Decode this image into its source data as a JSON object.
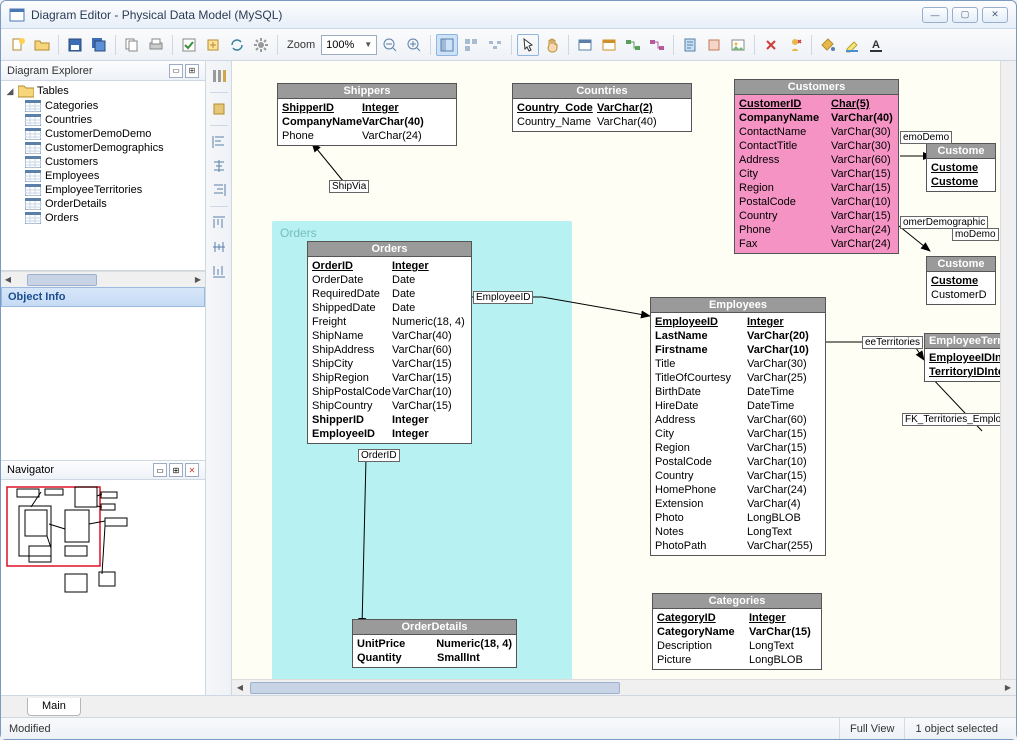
{
  "window": {
    "title": "Diagram Editor - Physical Data Model (MySQL)"
  },
  "toolbar": {
    "zoom_label": "Zoom",
    "zoom_value": "100%"
  },
  "explorer": {
    "title": "Diagram Explorer",
    "root": "Tables",
    "items": [
      "Categories",
      "Countries",
      "CustomerDemoDemo",
      "CustomerDemographics",
      "Customers",
      "Employees",
      "EmployeeTerritories",
      "OrderDetails",
      "Orders"
    ]
  },
  "objectinfo_title": "Object Info",
  "navigator_title": "Navigator",
  "tab_main": "Main",
  "status": {
    "left": "Modified",
    "mode": "Full View",
    "sel": "1 object selected"
  },
  "entities": {
    "shippers": {
      "title": "Shippers",
      "rows": [
        {
          "n": "ShipperID",
          "t": "Integer",
          "pk": true
        },
        {
          "n": "CompanyName",
          "t": "VarChar(40)",
          "fk": true
        },
        {
          "n": "Phone",
          "t": "VarChar(24)"
        }
      ]
    },
    "countries": {
      "title": "Countries",
      "rows": [
        {
          "n": "Country_Code",
          "t": "VarChar(2)",
          "pk": true
        },
        {
          "n": "Country_Name",
          "t": "VarChar(40)"
        }
      ]
    },
    "customers": {
      "title": "Customers",
      "rows": [
        {
          "n": "CustomerID",
          "t": "Char(5)",
          "pk": true
        },
        {
          "n": "CompanyName",
          "t": "VarChar(40)",
          "fk": true
        },
        {
          "n": "ContactName",
          "t": "VarChar(30)"
        },
        {
          "n": "ContactTitle",
          "t": "VarChar(30)"
        },
        {
          "n": "Address",
          "t": "VarChar(60)"
        },
        {
          "n": "City",
          "t": "VarChar(15)"
        },
        {
          "n": "Region",
          "t": "VarChar(15)"
        },
        {
          "n": "PostalCode",
          "t": "VarChar(10)"
        },
        {
          "n": "Country",
          "t": "VarChar(15)"
        },
        {
          "n": "Phone",
          "t": "VarChar(24)"
        },
        {
          "n": "Fax",
          "t": "VarChar(24)"
        }
      ]
    },
    "orders": {
      "title": "Orders",
      "rows": [
        {
          "n": "OrderID",
          "t": "Integer",
          "pk": true
        },
        {
          "n": "OrderDate",
          "t": "Date"
        },
        {
          "n": "RequiredDate",
          "t": "Date"
        },
        {
          "n": "ShippedDate",
          "t": "Date"
        },
        {
          "n": "Freight",
          "t": "Numeric(18, 4)"
        },
        {
          "n": "ShipName",
          "t": "VarChar(40)"
        },
        {
          "n": "ShipAddress",
          "t": "VarChar(60)"
        },
        {
          "n": "ShipCity",
          "t": "VarChar(15)"
        },
        {
          "n": "ShipRegion",
          "t": "VarChar(15)"
        },
        {
          "n": "ShipPostalCode",
          "t": "VarChar(10)"
        },
        {
          "n": "ShipCountry",
          "t": "VarChar(15)"
        },
        {
          "n": "ShipperID",
          "t": "Integer",
          "fk": true
        },
        {
          "n": "EmployeeID",
          "t": "Integer",
          "fk": true
        }
      ]
    },
    "employees": {
      "title": "Employees",
      "rows": [
        {
          "n": "EmployeeID",
          "t": "Integer",
          "pk": true
        },
        {
          "n": "LastName",
          "t": "VarChar(20)",
          "fk": true
        },
        {
          "n": "Firstname",
          "t": "VarChar(10)",
          "fk": true
        },
        {
          "n": "Title",
          "t": "VarChar(30)"
        },
        {
          "n": "TitleOfCourtesy",
          "t": "VarChar(25)"
        },
        {
          "n": "BirthDate",
          "t": "DateTime"
        },
        {
          "n": "HireDate",
          "t": "DateTime"
        },
        {
          "n": "Address",
          "t": "VarChar(60)"
        },
        {
          "n": "City",
          "t": "VarChar(15)"
        },
        {
          "n": "Region",
          "t": "VarChar(15)"
        },
        {
          "n": "PostalCode",
          "t": "VarChar(10)"
        },
        {
          "n": "Country",
          "t": "VarChar(15)"
        },
        {
          "n": "HomePhone",
          "t": "VarChar(24)"
        },
        {
          "n": "Extension",
          "t": "VarChar(4)"
        },
        {
          "n": "Photo",
          "t": "LongBLOB"
        },
        {
          "n": "Notes",
          "t": "LongText"
        },
        {
          "n": "PhotoPath",
          "t": "VarChar(255)"
        }
      ]
    },
    "categories": {
      "title": "Categories",
      "rows": [
        {
          "n": "CategoryID",
          "t": "Integer",
          "pk": true
        },
        {
          "n": "CategoryName",
          "t": "VarChar(15)",
          "fk": true
        },
        {
          "n": "Description",
          "t": "LongText"
        },
        {
          "n": "Picture",
          "t": "LongBLOB"
        }
      ]
    },
    "orderdetails": {
      "title": "OrderDetails",
      "rows": [
        {
          "n": "UnitPrice",
          "t": "Numeric(18, 4)",
          "fk": true
        },
        {
          "n": "Quantity",
          "t": "SmallInt",
          "fk": true
        }
      ]
    },
    "custstub1": {
      "title": "Custome",
      "rows": [
        {
          "n": "Custome",
          "t": "",
          "pk": true
        },
        {
          "n": "Custome",
          "t": "",
          "pk": true
        }
      ]
    },
    "custstub2": {
      "title": "Custome",
      "rows": [
        {
          "n": "Custome",
          "t": "",
          "pk": true
        },
        {
          "n": "CustomerD",
          "t": ""
        }
      ]
    },
    "empterr": {
      "title": "EmployeeTerritorie",
      "rows": [
        {
          "n": "EmployeeID",
          "t": "Integer",
          "pk": true
        },
        {
          "n": "TerritoryID",
          "t": "Integer",
          "pk": true
        }
      ]
    }
  },
  "labels": {
    "orders_group": "Orders",
    "shipvia": "ShipVia",
    "employeeid": "EmployeeID",
    "orderid": "OrderID",
    "demodemo": "emoDemo",
    "demographic": "omerDemographic",
    "modemo": "moDemo",
    "eeterritories": "eeTerritories",
    "fk_territories": "FK_Territories_Employee"
  }
}
